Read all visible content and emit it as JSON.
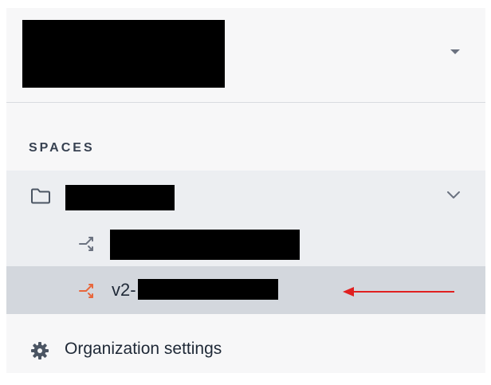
{
  "organization": {
    "name_redacted": true
  },
  "spaces": {
    "section_label": "SPACES",
    "space": {
      "name_redacted": true,
      "expanded": true,
      "environments": [
        {
          "label": "",
          "redacted": true
        },
        {
          "label": "v2-",
          "redacted_suffix": true,
          "selected": true
        }
      ]
    }
  },
  "footer": {
    "settings_label": "Organization settings"
  },
  "icons": {
    "org_caret": "caret-down-icon",
    "folder": "folder-icon",
    "space_chevron": "chevron-down-icon",
    "branch": "branch-icon",
    "settings": "gear-icon"
  },
  "colors": {
    "panel_bg": "#f7f7f8",
    "space_row_bg": "#eceef1",
    "selected_row_bg": "#d3d7dd",
    "branch_default": "#6b7280",
    "branch_active": "#e8673c",
    "annotation_arrow": "#e02020"
  }
}
